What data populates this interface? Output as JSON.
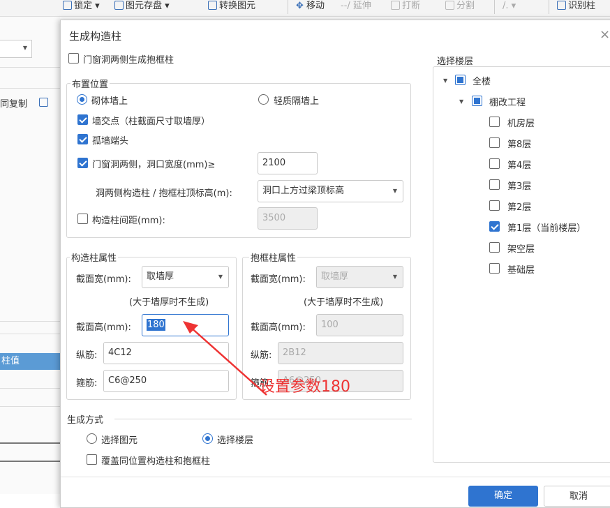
{
  "toolbar": {
    "items": [
      {
        "label": "锁定 ▾"
      },
      {
        "label": "图元存盘 ▾"
      },
      {
        "label": "转换图元"
      },
      {
        "label": "移动"
      },
      {
        "label": "延伸"
      },
      {
        "label": "打断"
      },
      {
        "label": "分割"
      },
      {
        "label": "/. ▾"
      },
      {
        "label": "识别柱"
      }
    ]
  },
  "background": {
    "copy_label": "同复制",
    "column_value_label": "柱值"
  },
  "dialog": {
    "title": "生成构造柱",
    "close_glyph": "×",
    "generate_frame_label": "门窗洞两侧生成抱框柱",
    "placement": {
      "group_label": "布置位置",
      "masonry_wall_label": "砌体墙上",
      "light_partition_label": "轻质隔墙上",
      "wall_intersection_label": "墙交点（柱截面尺寸取墙厚）",
      "isolated_wall_end_label": "孤墙端头",
      "door_window_both_sides_label": "门窗洞两侧，洞口宽度(mm)≥",
      "opening_width_value": "2100",
      "top_elevation_label": "洞两侧构造柱 / 抱框柱顶标高(m):",
      "top_elevation_value": "洞口上方过梁顶标高",
      "spacing_label": "构造柱间距(mm):",
      "spacing_value": "3500"
    },
    "column_props": {
      "group_label": "构造柱属性",
      "width_label": "截面宽(mm):",
      "width_value": "取墙厚",
      "note": "(大于墙厚时不生成)",
      "height_label": "截面高(mm):",
      "height_value": "180",
      "long_rebar_label": "纵筋:",
      "long_rebar_value": "4C12",
      "stirrup_label": "箍筋:",
      "stirrup_value": "C6@250"
    },
    "frame_props": {
      "group_label": "抱框柱属性",
      "width_label": "截面宽(mm):",
      "width_value": "取墙厚",
      "note": "(大于墙厚时不生成)",
      "height_label": "截面高(mm):",
      "height_value": "100",
      "long_rebar_label": "纵筋:",
      "long_rebar_value": "2B12",
      "stirrup_label": "箍筋:",
      "stirrup_value": "A6@250"
    },
    "generation": {
      "group_label": "生成方式",
      "select_element_label": "选择图元",
      "select_floor_label": "选择楼层",
      "overwrite_label": "覆盖同位置构造柱和抱框柱"
    },
    "floors": {
      "group_label": "选择楼层",
      "all_label": "全楼",
      "project_label": "棚改工程",
      "items": [
        {
          "label": "机房层",
          "checked": false
        },
        {
          "label": "第8层",
          "checked": false
        },
        {
          "label": "第4层",
          "checked": false
        },
        {
          "label": "第3层",
          "checked": false
        },
        {
          "label": "第2层",
          "checked": false
        },
        {
          "label": "第1层（当前楼层）",
          "checked": true
        },
        {
          "label": "架空层",
          "checked": false
        },
        {
          "label": "基础层",
          "checked": false
        }
      ]
    },
    "buttons": {
      "ok_label": "确定",
      "cancel_label": "取消"
    },
    "annotation": "设置参数180",
    "colors": {
      "accent": "#2f74d0",
      "annotation": "#ee3333"
    }
  }
}
